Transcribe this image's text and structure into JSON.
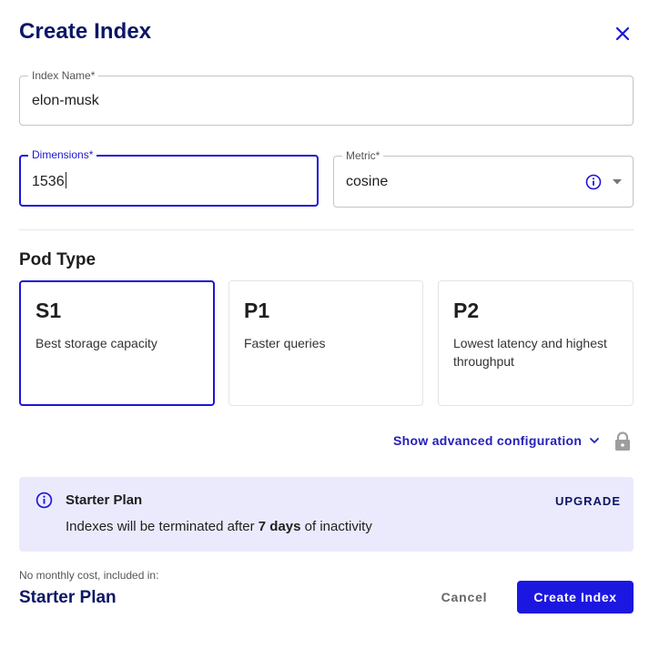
{
  "dialog": {
    "title": "Create Index"
  },
  "form": {
    "index_name": {
      "label": "Index Name",
      "required_mark": "*",
      "value": "elon-musk"
    },
    "dimensions": {
      "label": "Dimensions",
      "required_mark": "*",
      "value": "1536"
    },
    "metric": {
      "label": "Metric",
      "required_mark": "*",
      "value": "cosine"
    }
  },
  "pod_type": {
    "title": "Pod Type",
    "selected": "S1",
    "options": [
      {
        "name": "S1",
        "description": "Best storage capacity"
      },
      {
        "name": "P1",
        "description": "Faster queries"
      },
      {
        "name": "P2",
        "description": "Lowest latency and highest throughput"
      }
    ]
  },
  "advanced": {
    "label": "Show advanced configuration"
  },
  "banner": {
    "title": "Starter Plan",
    "text_before": "Indexes will be terminated after ",
    "text_bold": "7 days",
    "text_after": " of inactivity",
    "action": "UPGRADE"
  },
  "footer": {
    "cost_label": "No monthly cost, included in:",
    "plan": "Starter Plan",
    "cancel": "Cancel",
    "create": "Create Index"
  },
  "colors": {
    "primary": "#1c17e0",
    "title": "#0b1666",
    "banner_bg": "#ebeafd"
  },
  "icons": [
    "close-icon",
    "info-icon",
    "chevron-down-icon",
    "lock-icon",
    "dropdown-arrow-icon"
  ]
}
